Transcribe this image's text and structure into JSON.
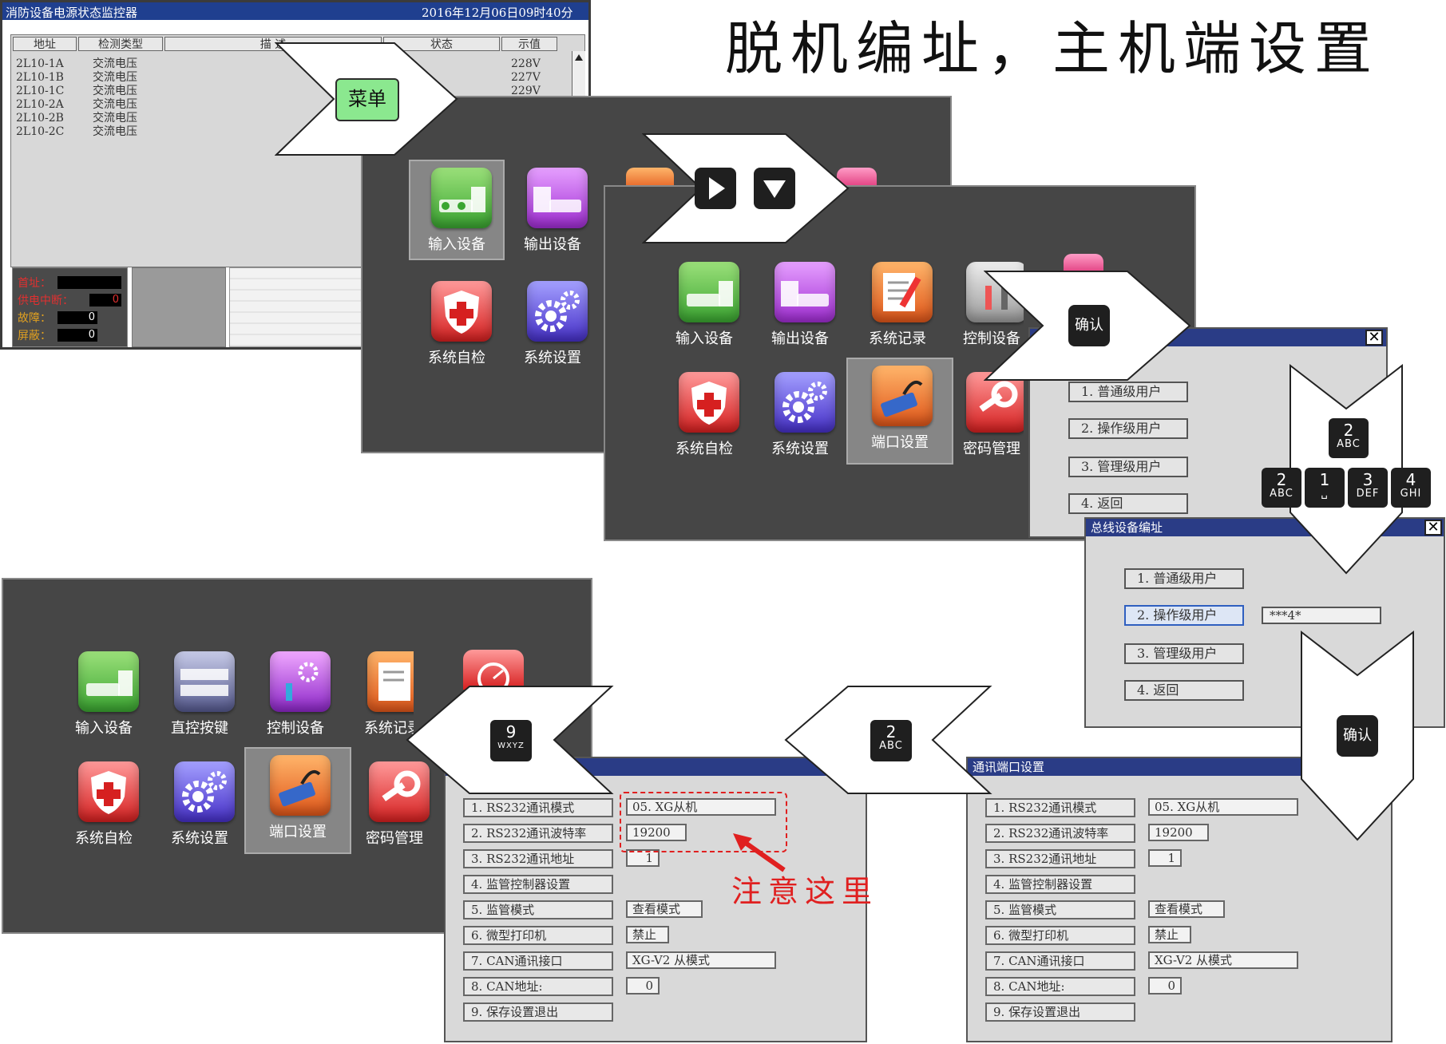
{
  "page_title": "脱机编址，主机端设置",
  "monitor": {
    "title": "消防设备电源状态监控器",
    "datetime": "2016年12月06日09时40分",
    "headers": [
      "地址",
      "检测类型",
      "描 述",
      "状态",
      "示值"
    ],
    "rows": [
      {
        "addr": "2L10-1A",
        "type": "交流电压",
        "value": "228V"
      },
      {
        "addr": "2L10-1B",
        "type": "交流电压",
        "value": "227V"
      },
      {
        "addr": "2L10-1C",
        "type": "交流电压",
        "value": "229V"
      },
      {
        "addr": "2L10-2A",
        "type": "交流电压",
        "value": ""
      },
      {
        "addr": "2L10-2B",
        "type": "交流电压",
        "value": ""
      },
      {
        "addr": "2L10-2C",
        "type": "交流电压",
        "value": ""
      }
    ],
    "status": {
      "first_label": "首址：",
      "power_label": "供电中断：",
      "power_value": "0",
      "fault_label": "故障：",
      "fault_value": "0",
      "shield_label": "屏蔽：",
      "shield_value": "0"
    }
  },
  "arrows": {
    "menu": "菜单",
    "confirm1": "确认",
    "confirm2": "确认",
    "play_icon": "play-icon",
    "down_icon": "down-icon"
  },
  "menu1": {
    "items": [
      "输入设备",
      "输出设备",
      "系统自检",
      "系统设置"
    ]
  },
  "menu2": {
    "items": [
      "输入设备",
      "输出设备",
      "系统记录",
      "控制设备",
      "系统自检",
      "系统设置",
      "端口设置",
      "密码管理"
    ],
    "label_control_visible": "控制设备",
    "label_pwd_visible": "密码管理"
  },
  "menu3": {
    "items": [
      "输入设备",
      "直控按键",
      "控制设备",
      "系统记录",
      "系统自检",
      "系统设置",
      "端口设置",
      "密码管理"
    ]
  },
  "user_dialog": {
    "options": [
      "1. 普通级用户",
      "2. 操作级用户",
      "3. 管理级用户",
      "4. 返回"
    ]
  },
  "bus_dialog": {
    "title": "总线设备编址",
    "options": [
      "1. 普通级用户",
      "2. 操作级用户",
      "3. 管理级用户",
      "4. 返回"
    ],
    "password": "***4*"
  },
  "keys": {
    "single": {
      "num": "2",
      "sub": "ABC"
    },
    "row": [
      {
        "num": "2",
        "sub": "ABC"
      },
      {
        "num": "1",
        "sub": "␣"
      },
      {
        "num": "3",
        "sub": "DEF"
      },
      {
        "num": "4",
        "sub": "GHI"
      }
    ],
    "nine": {
      "num": "9",
      "sub": "WXYZ"
    },
    "two": {
      "num": "2",
      "sub": "ABC"
    }
  },
  "port_left": {
    "rows": [
      "1. RS232通讯模式",
      "2. RS232通讯波特率",
      "3. RS232通讯地址",
      "4. 监管控制器设置",
      "5. 监管模式",
      "6. 微型打印机",
      "7. CAN通讯接口",
      "8. CAN地址:",
      "9. 保存设置退出"
    ],
    "values": [
      "05. XG从机",
      "19200",
      "1",
      "",
      "查看模式",
      "禁止",
      "XG-V2 从模式",
      "0",
      ""
    ]
  },
  "port_right": {
    "title": "通讯端口设置",
    "rows": [
      "1. RS232通讯模式",
      "2. RS232通讯波特率",
      "3. RS232通讯地址",
      "4. 监管控制器设置",
      "5. 监管模式",
      "6. 微型打印机",
      "7. CAN通讯接口",
      "8. CAN地址:",
      "9. 保存设置退出"
    ],
    "values": [
      "05. XG从机",
      "19200",
      "1",
      "",
      "查看模式",
      "禁止",
      "XG-V2 从模式",
      "0",
      ""
    ]
  },
  "annotation": "注意这里",
  "colors": {
    "accent_red": "#e02020",
    "title_blue": "#2a3c86",
    "panel_dark": "#464646"
  }
}
